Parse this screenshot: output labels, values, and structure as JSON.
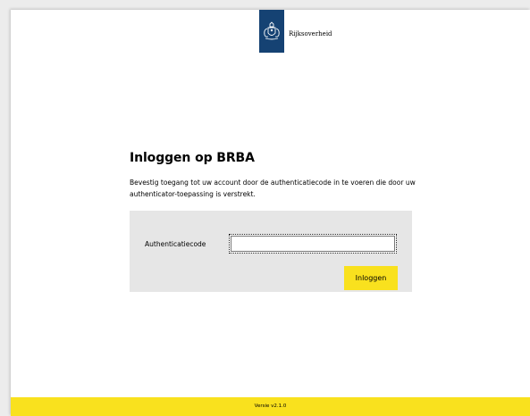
{
  "header": {
    "logo_text": "Rijksoverheid",
    "logo_color": "#154273"
  },
  "main": {
    "title": "Inloggen op BRBA",
    "intro": "Bevestig toegang tot uw account door de authenticatiecode in te voeren die door uw authenticator-toepassing is verstrekt.",
    "form": {
      "code_label": "Authenticatiecode",
      "code_value": "",
      "submit_label": "Inloggen"
    }
  },
  "footer": {
    "version": "Versie v2.1.0"
  },
  "colors": {
    "accent_yellow": "#f9e11e",
    "panel_gray": "#e6e6e6"
  }
}
